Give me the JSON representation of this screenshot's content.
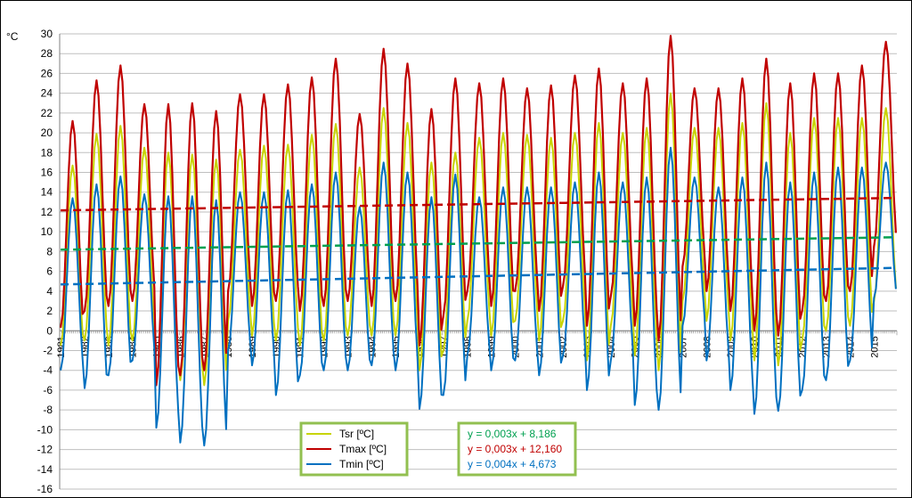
{
  "chart_data": {
    "type": "line",
    "ylabel": "°C",
    "ylim": [
      -16,
      30
    ],
    "y_ticks": [
      "30",
      "28",
      "26",
      "24",
      "22",
      "20",
      "18",
      "16",
      "14",
      "12",
      "10",
      "8",
      "6",
      "4",
      "2",
      "0",
      "-2",
      "-4",
      "-6",
      "-8",
      "-10",
      "-12",
      "-14",
      "-16"
    ],
    "x_ticks": [
      "1981",
      "1982",
      "1983",
      "1984",
      "1985",
      "1986",
      "1987",
      "1988",
      "1989",
      "1990",
      "1991",
      "1992",
      "1993",
      "1994",
      "1995",
      "1996",
      "1997",
      "1998",
      "1999",
      "2000",
      "2001",
      "2002",
      "2003",
      "2004",
      "2005",
      "2006",
      "2007",
      "2008",
      "2009",
      "2010",
      "2011",
      "2012",
      "2013",
      "2014",
      "2015"
    ],
    "grid": "horizontal",
    "series": [
      {
        "name": "Tsr  [ºC]",
        "color": "#c8d400",
        "approx_annual_min": [
          -1.5,
          -1.0,
          -1.5,
          -1.0,
          -5.0,
          -5.0,
          -5.5,
          1.0,
          -0.5,
          -1.0,
          -1.5,
          -1.0,
          -0.5,
          -0.5,
          -0.5,
          -4.0,
          -2.0,
          1.0,
          -0.5,
          1.0,
          -1.0,
          1.0,
          -3.0,
          0.5,
          -2.5,
          -4.0,
          3.0,
          1.0,
          -1.0,
          -3.0,
          -3.5,
          -1.0,
          0.0,
          0.5,
          3.0
        ],
        "approx_annual_max": [
          16.7,
          19.9,
          20.7,
          18.5,
          18.0,
          17.8,
          17.3,
          18.3,
          18.7,
          18.8,
          19.8,
          20.9,
          16.5,
          22.5,
          21.0,
          17.0,
          18.0,
          19.5,
          20.0,
          19.8,
          19.5,
          20.0,
          21.0,
          20.0,
          20.5,
          24.0,
          20.5,
          20.5,
          21.0,
          23.0,
          20.0,
          21.5,
          21.5,
          21.5,
          22.5
        ]
      },
      {
        "name": "Tmax  [ºC]",
        "color": "#c00000",
        "approx_annual_min": [
          0.3,
          2.0,
          2.5,
          3.0,
          -5.5,
          -4.5,
          -4.0,
          4.0,
          2.5,
          3.0,
          2.0,
          2.5,
          3.0,
          2.5,
          3.0,
          -1.5,
          1.5,
          4.0,
          2.5,
          4.0,
          2.0,
          4.5,
          0.5,
          3.5,
          0.5,
          -1.0,
          6.5,
          4.0,
          2.0,
          0.0,
          -0.5,
          2.0,
          3.0,
          4.0,
          8.5
        ],
        "approx_annual_max": [
          21.2,
          25.3,
          26.8,
          22.9,
          22.9,
          23.0,
          22.2,
          23.9,
          23.9,
          24.9,
          25.6,
          27.5,
          21.9,
          28.5,
          27.0,
          22.4,
          25.5,
          25.0,
          25.5,
          24.5,
          24.8,
          25.8,
          26.5,
          25.0,
          25.5,
          29.8,
          24.5,
          24.5,
          25.5,
          27.5,
          25.0,
          26.0,
          26.0,
          26.8,
          29.2
        ],
        "annotation": "y = 0,003x + 12,160"
      },
      {
        "name": "Tmin  [ºC]",
        "color": "#0070c0",
        "approx_annual_min": [
          -4.0,
          -5.8,
          -4.5,
          -3.0,
          -9.8,
          -11.3,
          -11.6,
          -2.0,
          -3.5,
          -6.5,
          -4.5,
          -4.0,
          -4.0,
          -3.5,
          -4.0,
          -7.9,
          -6.5,
          -2.5,
          -4.0,
          -3.0,
          -4.5,
          -2.5,
          -6.0,
          -3.0,
          -7.5,
          -8.0,
          0.5,
          -3.0,
          -6.0,
          -8.4,
          -8.1,
          -6.0,
          -5.0,
          -3.0,
          3.3
        ],
        "approx_annual_max": [
          13.4,
          14.8,
          15.6,
          13.8,
          13.6,
          13.6,
          13.2,
          14.0,
          14.0,
          14.2,
          14.8,
          16.0,
          12.5,
          17.0,
          16.0,
          13.5,
          15.8,
          13.5,
          14.5,
          14.5,
          14.5,
          15.0,
          16.0,
          15.0,
          15.5,
          18.5,
          15.5,
          14.5,
          15.5,
          17.0,
          15.0,
          16.0,
          16.5,
          16.5,
          17.0
        ],
        "annotation": "y = 0,004x + 4,673"
      }
    ],
    "trendlines": [
      {
        "series": "Tsr  [ºC]",
        "slope": 0.003,
        "intercept": 8.186,
        "color": "#00a050",
        "label": "y = 0,003x + 8,186"
      },
      {
        "series": "Tmax  [ºC]",
        "slope": 0.003,
        "intercept": 12.16,
        "color": "#c00000",
        "label": "y = 0,003x + 12,160"
      },
      {
        "series": "Tmin  [ºC]",
        "slope": 0.004,
        "intercept": 4.673,
        "color": "#0070c0",
        "label": "y = 0,004x + 4,673"
      }
    ],
    "legend_placement": "bottom-center"
  }
}
